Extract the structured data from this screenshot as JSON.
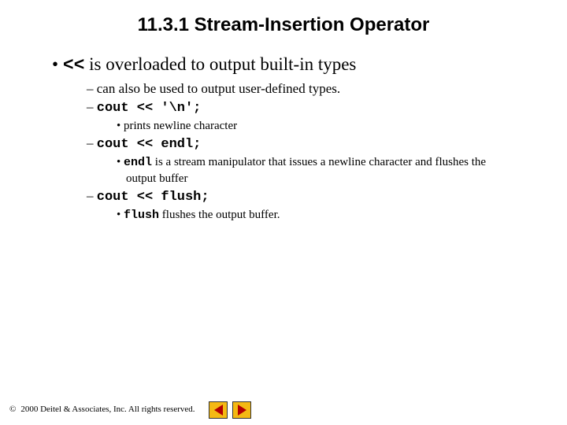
{
  "title": "11.3.1   Stream-Insertion Operator",
  "bullet1_op": "<<",
  "bullet1_rest": " is overloaded to output built-in types",
  "sub1": "can also be used to output user-defined types.",
  "sub2_code": "cout << '\\n';",
  "sub2a": "prints newline character",
  "sub3_code": "cout << endl;",
  "sub3a_code": "endl",
  "sub3a_rest": " is a stream manipulator that issues a newline character and flushes the output buffer",
  "sub4_code": "cout << flush;",
  "sub4a_code": "flush",
  "sub4a_rest": " flushes the output buffer.",
  "copyright": "2000 Deitel & Associates, Inc.  All rights reserved."
}
